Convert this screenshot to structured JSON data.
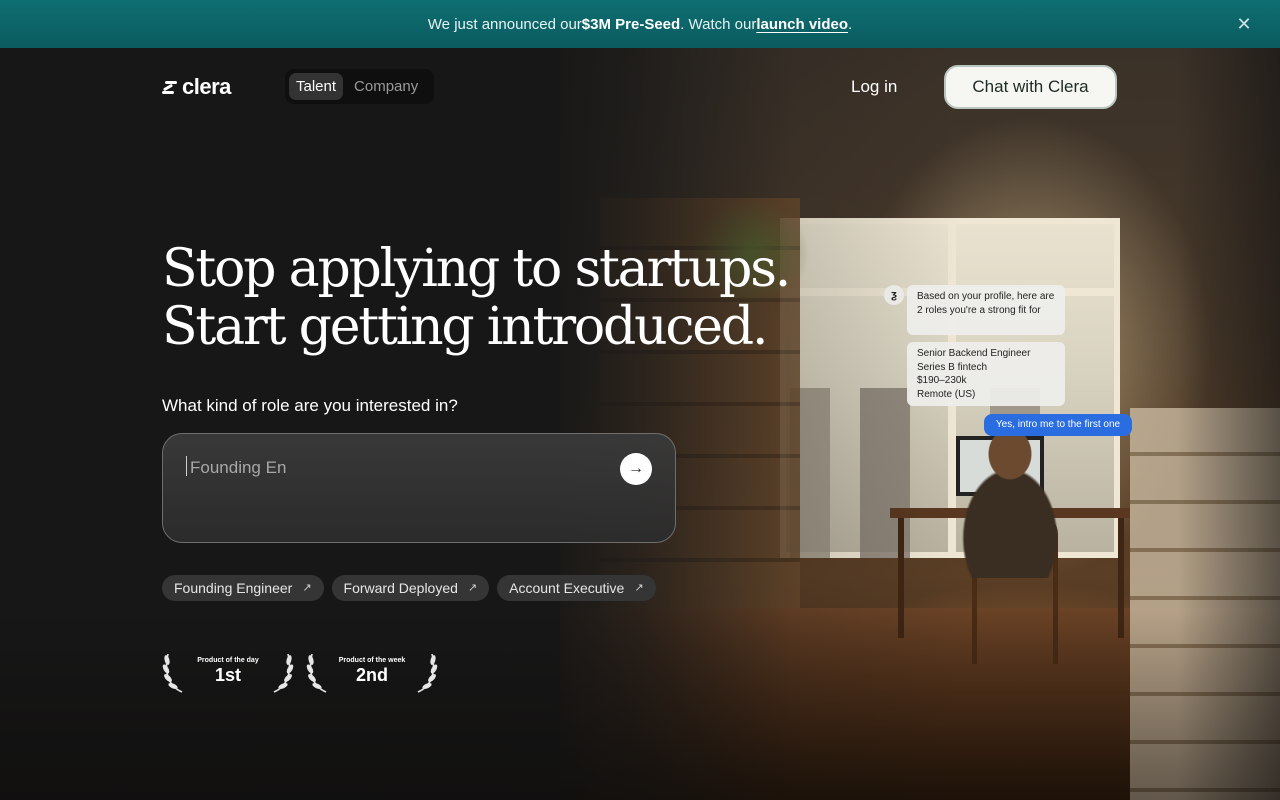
{
  "announcement": {
    "prefix": "We just announced our ",
    "highlight": "$3M Pre-Seed",
    "middle": ". Watch our ",
    "link": "launch video",
    "suffix": ".",
    "close_icon": "close-icon"
  },
  "nav": {
    "logo": "clera",
    "toggle": [
      "Talent",
      "Company"
    ],
    "active_toggle": "Talent",
    "login": "Log in",
    "cta": "Chat with Clera"
  },
  "hero": {
    "headline_line1": "Stop applying to startups.",
    "headline_line2": "Start getting introduced.",
    "question": "What kind of role are you interested in?",
    "input_value": "Founding En",
    "send_icon": "arrow-right-icon"
  },
  "chips": [
    {
      "label": "Founding Engineer",
      "icon": "arrow-up-right-icon"
    },
    {
      "label": "Forward Deployed",
      "icon": "arrow-up-right-icon"
    },
    {
      "label": "Account Executive",
      "icon": "arrow-up-right-icon"
    }
  ],
  "awards": [
    {
      "label": "Product of the day",
      "rank": "1st"
    },
    {
      "label": "Product of the week",
      "rank": "2nd"
    }
  ],
  "chat_preview": {
    "bot_message": "Based on your profile, here are 2 roles you're a strong fit for",
    "role_card": [
      "Senior Backend Engineer",
      "Series B fintech",
      "$190–230k",
      "Remote (US)"
    ],
    "user_reply": "Yes, intro me to the first one"
  },
  "colors": {
    "announcement_bg": "#0b6367",
    "background": "#171717",
    "cta_bg": "#f6f7f2",
    "reply_bubble": "#2a6de0"
  }
}
